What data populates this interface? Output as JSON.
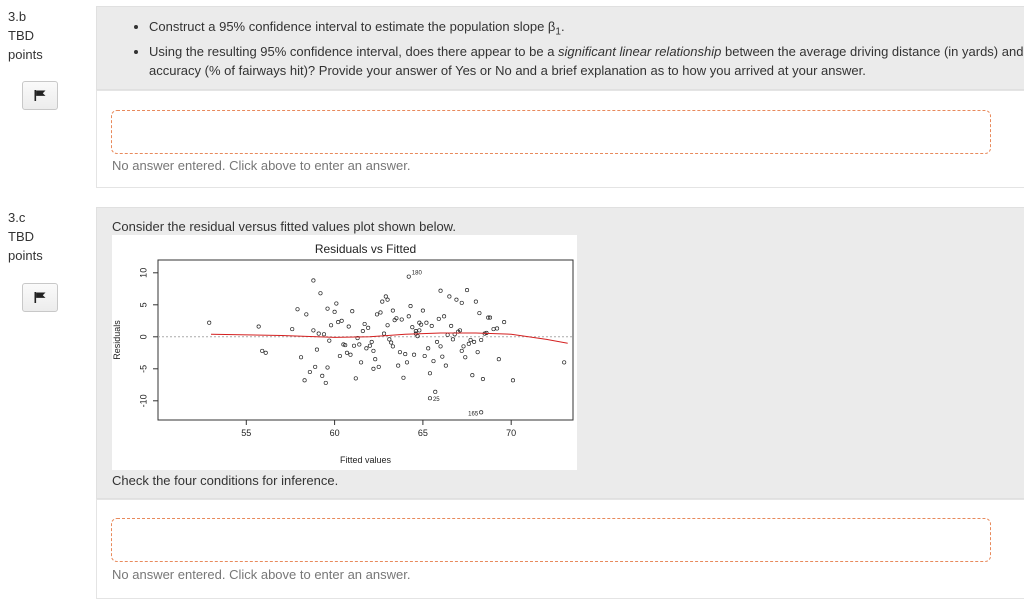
{
  "q3b": {
    "number": "3.b",
    "status": "TBD",
    "points_label": "points",
    "bullets": [
      "Construct a 95% confidence interval to estimate the population slope β",
      "Using the resulting 95% confidence interval, does there appear to be a ",
      "between the average driving distance (in yards) and accuracy (% of fairways hit)? Provide your answer of Yes or No and a brief explanation as to how you arrived at your answer."
    ],
    "bullet1_subscript": "1",
    "bullet1_tail": ".",
    "bullet2_italic": "significant linear relationship",
    "no_answer": "No answer entered. Click above to enter an answer."
  },
  "q3c": {
    "number": "3.c",
    "status": "TBD",
    "points_label": "points",
    "intro": "Consider the residual versus fitted values plot shown below.",
    "question": "Check the four conditions for inference.",
    "no_answer": "No answer entered. Click above to enter an answer."
  },
  "colors": {
    "flag": "#222222",
    "smooth": "#d42020",
    "answer_border": "#e88a5c",
    "panel": "#ebebeb"
  },
  "icons": {
    "flag": "flag-icon"
  },
  "chart_data": {
    "type": "scatter",
    "title": "Residuals vs Fitted",
    "xlabel": "Fitted values",
    "ylabel": "Residuals",
    "xlim": [
      50,
      73.5
    ],
    "ylim": [
      -13,
      12
    ],
    "xticks": [
      55,
      60,
      65,
      70
    ],
    "yticks": [
      10,
      5,
      0,
      -5,
      -10
    ],
    "reference_line_y": 0,
    "labeled_points": [
      {
        "label": "180",
        "x": 64.2,
        "y": 9.4
      },
      {
        "label": "25",
        "x": 65.4,
        "y": -9.6
      },
      {
        "label": "165",
        "x": 68.3,
        "y": -11.8
      }
    ],
    "smooth": {
      "x": [
        53,
        57,
        60,
        62,
        64,
        66,
        68,
        70,
        72,
        73.2
      ],
      "y": [
        0.4,
        0.2,
        -0.1,
        0.0,
        0.4,
        0.6,
        0.6,
        0.4,
        -0.4,
        -1.0
      ]
    },
    "points": {
      "x": [
        52.9,
        55.7,
        55.9,
        56.1,
        58.1,
        58.3,
        58.6,
        59.0,
        59.3,
        59.5,
        59.6,
        58.8,
        57.6,
        57.9,
        58.4,
        58.8,
        59.2,
        59.8,
        60.1,
        60.4,
        60.6,
        60.9,
        61.2,
        61.5,
        61.8,
        62.1,
        62.4,
        62.7,
        63.0,
        63.3,
        63.6,
        63.9,
        64.2,
        64.5,
        64.8,
        65.1,
        65.4,
        65.7,
        66.0,
        66.3,
        66.6,
        66.9,
        67.2,
        67.5,
        67.8,
        68.1,
        68.4,
        68.7,
        69.0,
        69.3,
        69.6,
        70.1,
        73.0,
        59.1,
        59.7,
        60.2,
        60.8,
        61.3,
        61.7,
        62.3,
        62.8,
        63.2,
        63.8,
        64.3,
        64.7,
        65.2,
        65.8,
        66.2,
        66.8,
        67.3,
        67.7,
        68.2,
        68.6,
        60.5,
        61.0,
        61.6,
        62.2,
        62.6,
        63.1,
        63.5,
        64.1,
        64.6,
        65.0,
        65.5,
        66.1,
        66.5,
        67.0,
        67.6,
        68.0,
        68.5,
        62.0,
        63.7,
        64.4,
        65.3,
        66.4,
        67.1,
        58.9,
        59.4,
        60.3,
        61.1,
        61.9,
        62.5,
        63.4,
        64.9,
        65.6,
        66.7,
        67.4,
        68.3,
        69.2,
        64.0,
        63.0,
        60.7,
        61.4,
        62.9,
        64.6,
        65.9,
        67.9,
        59.6,
        60.0,
        62.2,
        63.3,
        64.8,
        66.0,
        67.2,
        68.8
      ],
      "y": [
        2.2,
        1.6,
        -2.2,
        -2.5,
        -3.2,
        -6.8,
        -5.5,
        -2.0,
        -6.1,
        -7.2,
        -4.8,
        1.0,
        1.2,
        4.3,
        3.5,
        8.8,
        6.8,
        1.8,
        5.2,
        2.5,
        -1.3,
        -2.8,
        -6.5,
        -4.0,
        -1.8,
        -0.8,
        3.5,
        5.5,
        1.8,
        -1.5,
        -4.5,
        -6.4,
        3.2,
        -2.8,
        1.0,
        -3.0,
        -5.7,
        -8.6,
        -1.5,
        -4.5,
        1.7,
        5.8,
        -2.2,
        7.3,
        -6.0,
        -2.4,
        -6.6,
        3.0,
        1.2,
        -3.5,
        2.3,
        -6.8,
        -4.0,
        0.5,
        -0.6,
        2.3,
        1.6,
        -0.2,
        2.0,
        -3.5,
        0.5,
        -0.9,
        2.7,
        4.8,
        0.1,
        2.2,
        -0.8,
        3.2,
        0.4,
        -1.5,
        -0.5,
        3.7,
        0.6,
        -1.2,
        4.0,
        0.9,
        -5.0,
        3.8,
        -0.4,
        2.9,
        -4.0,
        0.5,
        4.1,
        1.7,
        -3.1,
        6.3,
        0.8,
        -1.1,
        5.5,
        0.5,
        -1.4,
        -2.4,
        1.5,
        -1.8,
        0.3,
        1.0,
        -4.7,
        0.4,
        -3.0,
        -1.4,
        1.4,
        -4.7,
        2.6,
        1.9,
        -3.8,
        -0.4,
        -3.2,
        -0.5,
        1.3,
        -2.7,
        5.8,
        -2.5,
        -1.2,
        6.3,
        0.9,
        2.8,
        -0.8,
        4.4,
        3.9,
        -2.2,
        4.1,
        2.2,
        7.2,
        5.3,
        3.0,
        -4.6
      ]
    }
  }
}
